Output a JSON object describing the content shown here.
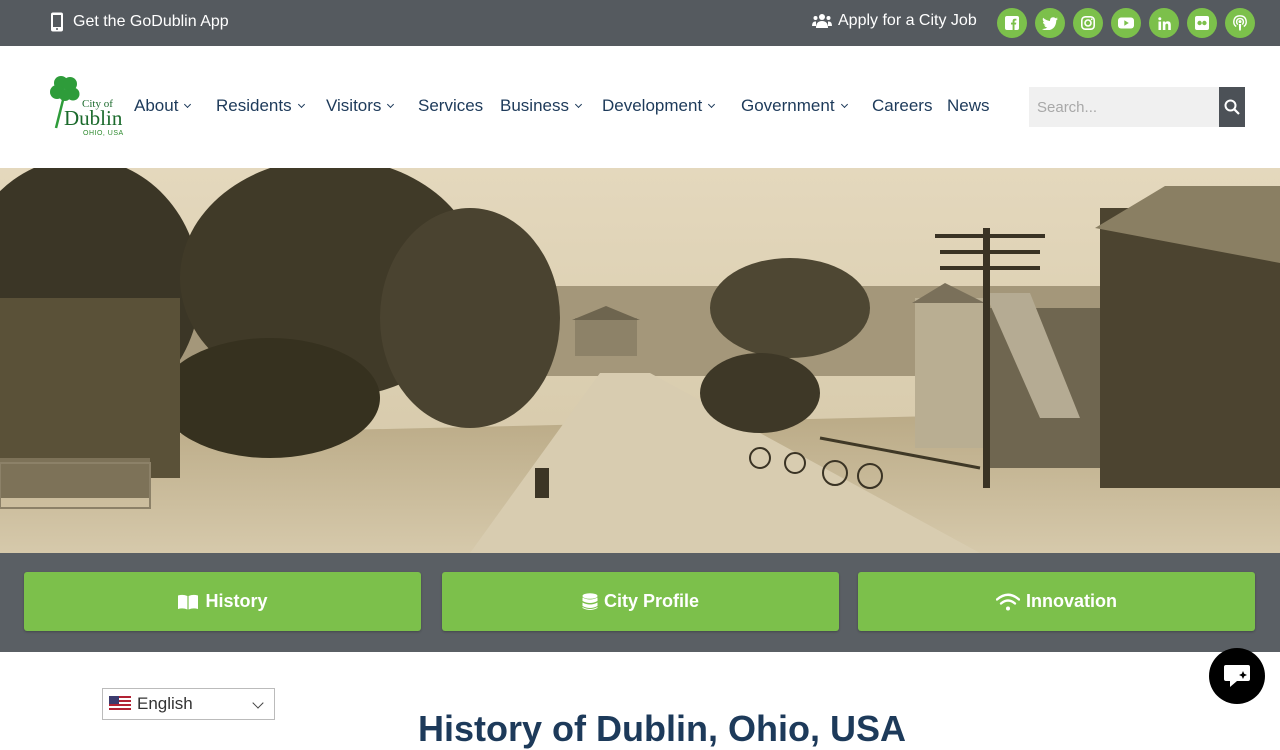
{
  "topbar": {
    "app_label": "Get the GoDublin App",
    "job_label": "Apply for a City Job",
    "socials": [
      "facebook-icon",
      "twitter-icon",
      "instagram-icon",
      "youtube-icon",
      "linkedin-icon",
      "flickr-icon",
      "podcast-icon"
    ]
  },
  "logo": {
    "line1": "City of",
    "line2": "Dublin",
    "line3": "OHIO, USA"
  },
  "nav": {
    "items": [
      {
        "label": "About",
        "dropdown": true
      },
      {
        "label": "Residents",
        "dropdown": true
      },
      {
        "label": "Visitors",
        "dropdown": true
      },
      {
        "label": "Services",
        "dropdown": false
      },
      {
        "label": "Business",
        "dropdown": true
      },
      {
        "label": "Development",
        "dropdown": true
      },
      {
        "label": "Government",
        "dropdown": true
      },
      {
        "label": "Careers",
        "dropdown": false
      },
      {
        "label": "News",
        "dropdown": false
      }
    ]
  },
  "search": {
    "placeholder": "Search..."
  },
  "buttons": {
    "history": "History",
    "city_profile": "City Profile",
    "innovation": "Innovation"
  },
  "language": {
    "selected": "English"
  },
  "page": {
    "heading": "History of Dublin, Ohio, USA"
  },
  "colors": {
    "topbar": "#555a5f",
    "accent_green": "#7cc04b",
    "nav_text": "#1d3a5a",
    "band": "#5a5f64"
  }
}
